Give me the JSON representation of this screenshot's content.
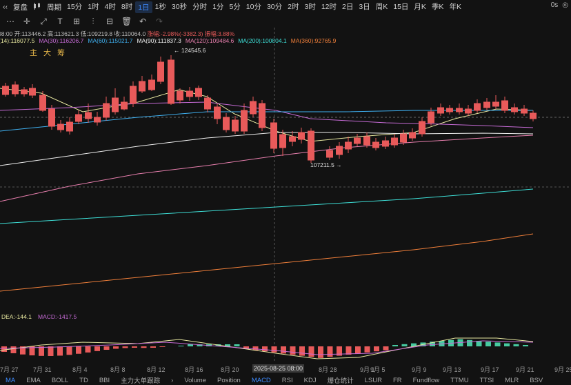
{
  "toolbar": {
    "back_label": "‹‹",
    "fuquan": "复盘",
    "chart_icon": "candlestick-icon",
    "period": "周期",
    "intervals": [
      "15分",
      "1时",
      "4时",
      "8时",
      "1日",
      "1秒",
      "30秒",
      "分时",
      "1分",
      "5分",
      "10分",
      "30分",
      "2时",
      "3时",
      "12时",
      "2日",
      "3日",
      "周K",
      "15日",
      "月K",
      "季K",
      "年K"
    ],
    "active_interval": "1日",
    "clock": "0s"
  },
  "tools": [
    "more-icon",
    "crosshair-icon",
    "expand-icon",
    "text-icon",
    "grid-icon",
    "chart-type-icon",
    "indicator-icon",
    "trash-icon",
    "undo-icon",
    "redo-icon"
  ],
  "ohlc": {
    "time": "08:00",
    "open": "开:113446.2",
    "high": "高:113621.3",
    "low": "低:109219.8",
    "close": "收:110064.0",
    "change": "涨幅:-2.98%(-3382.3)",
    "amp": "振幅:3.88%"
  },
  "ma": [
    {
      "label": "(14):116077.5",
      "color": "#e8e8a0"
    },
    {
      "label": "MA(30):116206.7",
      "color": "#c66bd6"
    },
    {
      "label": "MA(60):115021.7",
      "color": "#3fb0f0"
    },
    {
      "label": "MA(90):111837.3",
      "color": "#f0f0f0"
    },
    {
      "label": "MA(120):109484.6",
      "color": "#e87fae"
    },
    {
      "label": "MA(200):100804.1",
      "color": "#3ee0d8"
    },
    {
      "label": "MA(360):92765.9",
      "color": "#f07f3a"
    }
  ],
  "indicators_top": [
    "主",
    "大",
    "筹"
  ],
  "annotations": {
    "high": "← 124545.6",
    "low": "107211.5 →"
  },
  "macd": {
    "dea": "DEA:-144.1",
    "macd": "MACD:-1417.5"
  },
  "xaxis": {
    "labels": [
      "7月 27",
      "7月 31",
      "8月 4",
      "8月 8",
      "8月 12",
      "8月 16",
      "8月 20",
      "2025-08-25 08:00",
      "8月 28",
      "9月 1",
      "9月 5",
      "9月 9",
      "9月 13",
      "9月 17",
      "9月 21",
      "9月 25"
    ],
    "highlight": "2025-08-25 08:00"
  },
  "bottom_tabs": [
    "MA",
    "EMA",
    "BOLL",
    "TD",
    "BBI",
    "主力大单跟踪",
    "›",
    "Volume",
    "Position",
    "MACD",
    "RSI",
    "KDJ",
    "爆仓统计",
    "LSUR",
    "FR",
    "Fundflow",
    "TTMU",
    "TTSI",
    "MLR",
    "BSV"
  ],
  "bottom_active": [
    "MA",
    "MACD"
  ],
  "colors": {
    "up": "#46c9a0",
    "down": "#e85a5a",
    "accent": "#3d8bff",
    "bg": "#121212"
  },
  "chart_data": {
    "type": "candlestick",
    "categories": [
      "7月 27",
      "7月 31",
      "8月 4",
      "8月 8",
      "8月 12",
      "8月 16",
      "8月 20",
      "8月 25",
      "8月 28",
      "9月 1",
      "9月 5",
      "9月 9",
      "9月 13",
      "9月 17",
      "9月 21",
      "9月 25"
    ],
    "price_high": 124545.6,
    "price_low": 107211.5,
    "last_close": 110064.0,
    "macd_dea": -144.1,
    "macd_value": -1417.5
  }
}
